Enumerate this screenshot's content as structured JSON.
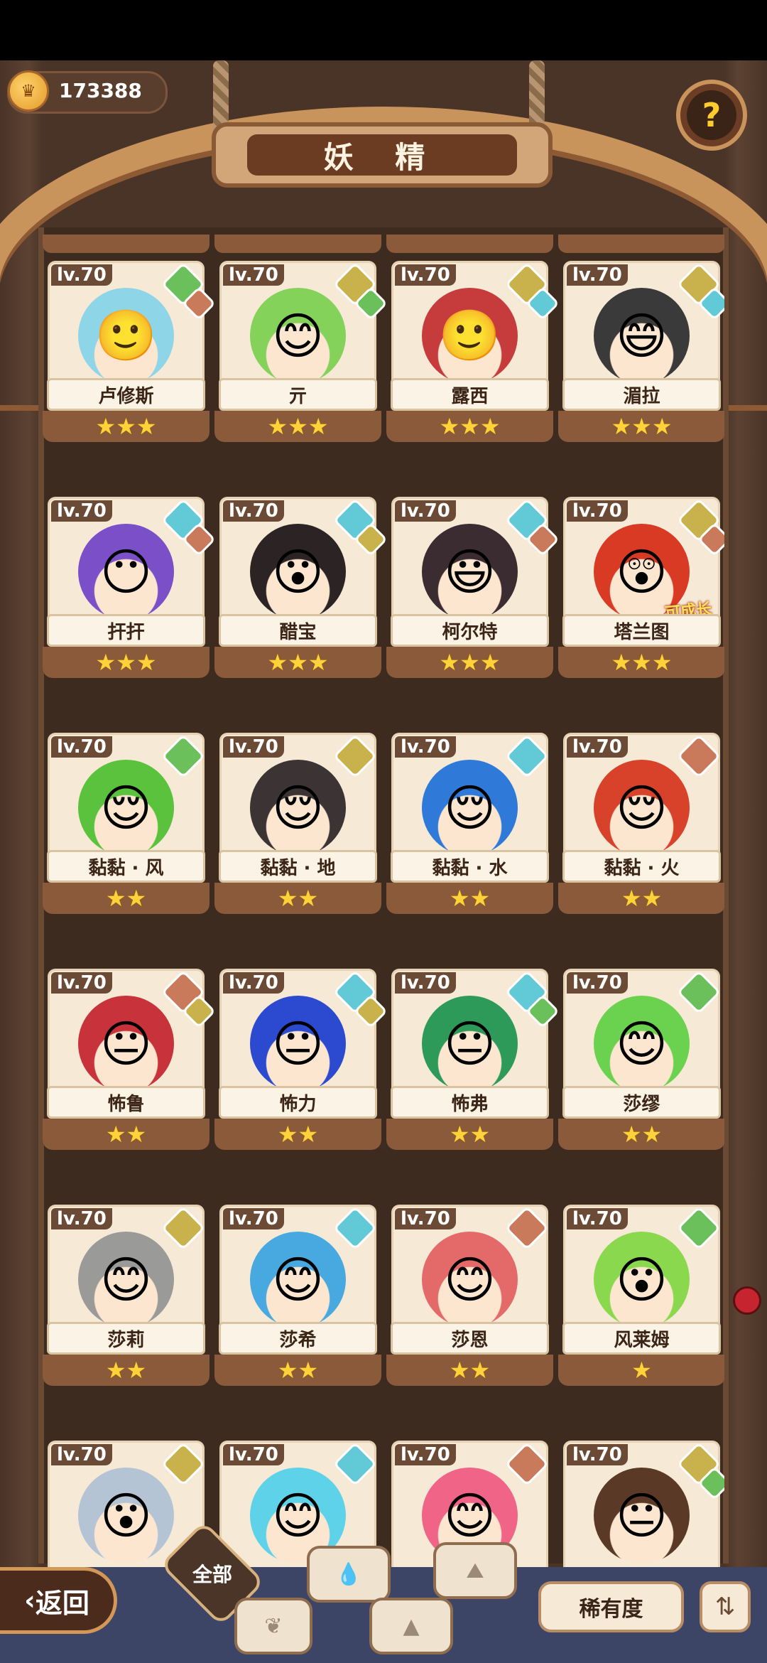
{
  "header": {
    "coins": "173388",
    "title": "妖 精",
    "help_icon": "question-flower-icon"
  },
  "colors": {
    "earth": "#c9b24b",
    "water": "#62c9d6",
    "wood": "#6cc05c",
    "fire": "#c97a5b",
    "neutral": "#7a6a5a"
  },
  "cards": [
    {
      "lv": "lv.70",
      "name": "卢修斯",
      "stars": "★★★",
      "el1": "wood",
      "el2": "fire",
      "hair": "#8fd5e8",
      "face": "🙂"
    },
    {
      "lv": "lv.70",
      "name": "亓",
      "stars": "★★★",
      "el1": "earth",
      "el2": "wood",
      "hair": "#84d25a",
      "face": "😊"
    },
    {
      "lv": "lv.70",
      "name": "露西",
      "stars": "★★★",
      "el1": "earth",
      "el2": "water",
      "hair": "#c63c3c",
      "face": "🙂"
    },
    {
      "lv": "lv.70",
      "name": "湄拉",
      "stars": "★★★",
      "el1": "earth",
      "el2": "water",
      "hair": "#3a3a3a",
      "face": "😄"
    },
    {
      "lv": "lv.70",
      "name": "扞扞",
      "stars": "★★★",
      "el1": "water",
      "el2": "fire",
      "hair": "#7a4fc8",
      "face": "😶"
    },
    {
      "lv": "lv.70",
      "name": "醋宝",
      "stars": "★★★",
      "el1": "water",
      "el2": "earth",
      "hair": "#2c2424",
      "face": "😮"
    },
    {
      "lv": "lv.70",
      "name": "柯尔特",
      "stars": "★★★",
      "el1": "water",
      "el2": "fire",
      "hair": "#3a2c30",
      "face": "😃"
    },
    {
      "lv": "lv.70",
      "name": "塔兰图",
      "stars": "★★★",
      "el1": "earth",
      "el2": "fire",
      "hair": "#d83a24",
      "face": "😲",
      "tag": "可成长"
    },
    {
      "lv": "lv.70",
      "name": "黏黏 · 风",
      "stars": "★★",
      "el1": "wood",
      "el2": "",
      "hair": "#5ac23c",
      "face": "😌"
    },
    {
      "lv": "lv.70",
      "name": "黏黏 · 地",
      "stars": "★★",
      "el1": "earth",
      "el2": "",
      "hair": "#3c3434",
      "face": "😌"
    },
    {
      "lv": "lv.70",
      "name": "黏黏 · 水",
      "stars": "★★",
      "el1": "water",
      "el2": "",
      "hair": "#2f7ad8",
      "face": "😌"
    },
    {
      "lv": "lv.70",
      "name": "黏黏 · 火",
      "stars": "★★",
      "el1": "fire",
      "el2": "",
      "hair": "#d8422a",
      "face": "😌"
    },
    {
      "lv": "lv.70",
      "name": "怖鲁",
      "stars": "★★",
      "el1": "fire",
      "el2": "earth",
      "hair": "#c8323a",
      "face": "😐"
    },
    {
      "lv": "lv.70",
      "name": "怖力",
      "stars": "★★",
      "el1": "water",
      "el2": "earth",
      "hair": "#2c4ad0",
      "face": "😐"
    },
    {
      "lv": "lv.70",
      "name": "怖弗",
      "stars": "★★",
      "el1": "water",
      "el2": "wood",
      "hair": "#2e9a5a",
      "face": "😐"
    },
    {
      "lv": "lv.70",
      "name": "莎缪",
      "stars": "★★",
      "el1": "wood",
      "el2": "",
      "hair": "#6ad24e",
      "face": "😊"
    },
    {
      "lv": "lv.70",
      "name": "莎莉",
      "stars": "★★",
      "el1": "earth",
      "el2": "",
      "hair": "#9a9a98",
      "face": "😊"
    },
    {
      "lv": "lv.70",
      "name": "莎希",
      "stars": "★★",
      "el1": "water",
      "el2": "",
      "hair": "#48a8e0",
      "face": "😊"
    },
    {
      "lv": "lv.70",
      "name": "莎恩",
      "stars": "★★",
      "el1": "fire",
      "el2": "",
      "hair": "#e46a6a",
      "face": "😊"
    },
    {
      "lv": "lv.70",
      "name": "风莱姆",
      "stars": "★",
      "el1": "wood",
      "el2": "",
      "hair": "#8ad84e",
      "face": "😮"
    },
    {
      "lv": "lv.70",
      "name": "",
      "stars": "",
      "el1": "earth",
      "el2": "",
      "hair": "#b4c4d4",
      "face": "😮"
    },
    {
      "lv": "lv.70",
      "name": "",
      "stars": "",
      "el1": "water",
      "el2": "",
      "hair": "#5ed2e8",
      "face": "😊"
    },
    {
      "lv": "lv.70",
      "name": "",
      "stars": "",
      "el1": "fire",
      "el2": "",
      "hair": "#f06488",
      "face": "😊"
    },
    {
      "lv": "lv.70",
      "name": "",
      "stars": "",
      "el1": "earth",
      "el2": "wood",
      "hair": "#5a3a26",
      "face": "😐"
    }
  ],
  "bottom": {
    "back_label": "返回",
    "filter_all": "全部",
    "filters": [
      "water-icon",
      "wood-icon",
      "earth-icon",
      "mountain-icon"
    ],
    "rarity_label": "稀有度",
    "sort_icon": "sort-icon"
  }
}
